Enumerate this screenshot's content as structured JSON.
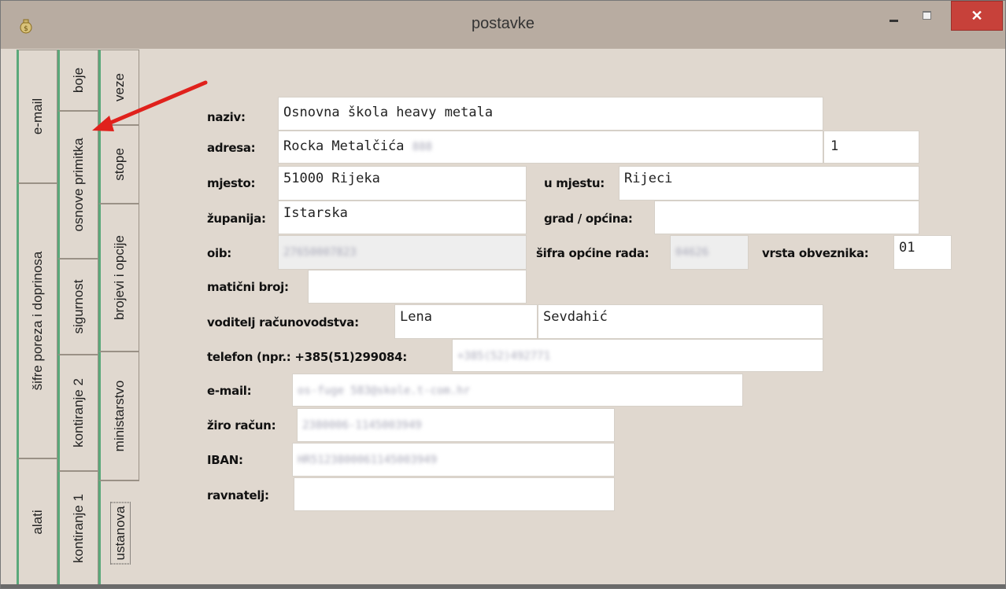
{
  "window": {
    "title": "postavke",
    "close_glyph": "✕"
  },
  "tabs_col1": [
    "e-mail",
    "šifre poreza i doprinosa",
    "alati"
  ],
  "tabs_col2": [
    "boje",
    "osnove primitka",
    "sigurnost",
    "kontiranje 2",
    "kontiranje 1"
  ],
  "tabs_col3": [
    "veze",
    "stope",
    "brojevi i opcije",
    "ministarstvo",
    "ustanova"
  ],
  "active_tab": "ustanova",
  "form": {
    "naziv_label": "naziv:",
    "naziv_value": "Osnovna škola heavy metala",
    "adresa_label": "adresa:",
    "adresa_value": "Rocka Metalčića",
    "adresa_blur": "888",
    "adresa_broj": "1",
    "mjesto_label": "mjesto:",
    "mjesto_value": "51000 Rijeka",
    "u_mjestu_label": "u mjestu:",
    "u_mjestu_value": "Rijeci",
    "zupanija_label": "županija:",
    "zupanija_value": "Istarska",
    "grad_label": "grad / općina:",
    "grad_value": "",
    "oib_label": "oib:",
    "oib_value": "27650007823",
    "sifra_opcine_label": "šifra općine rada:",
    "sifra_opcine_value": "04626",
    "vrsta_label": "vrsta obveznika:",
    "vrsta_value": "01",
    "maticni_label": "matični broj:",
    "maticni_value": "",
    "voditelj_label": "voditelj računovodstva:",
    "voditelj_ime": "Lena",
    "voditelj_prezime": "Sevdahić",
    "telefon_label": "telefon (npr.: +385(51)299084:",
    "telefon_value": "+385(52)492771",
    "email_label": "e-mail:",
    "email_value": "os-fuge 583@skole.t-com.hr",
    "ziro_label": "žiro račun:",
    "ziro_value": "2380006-1145003949",
    "iban_label": "IBAN:",
    "iban_value": "HR5123800061145003949",
    "ravnatelj_label": "ravnatelj:",
    "ravnatelj_value": ""
  },
  "annotation": {
    "arrow_color": "#e0211c",
    "arrow_target": "osnove primitka"
  },
  "icons": {
    "app": "moneybag-icon",
    "minimize": "minimize-icon",
    "maximize": "maximize-icon",
    "close": "close-icon"
  }
}
